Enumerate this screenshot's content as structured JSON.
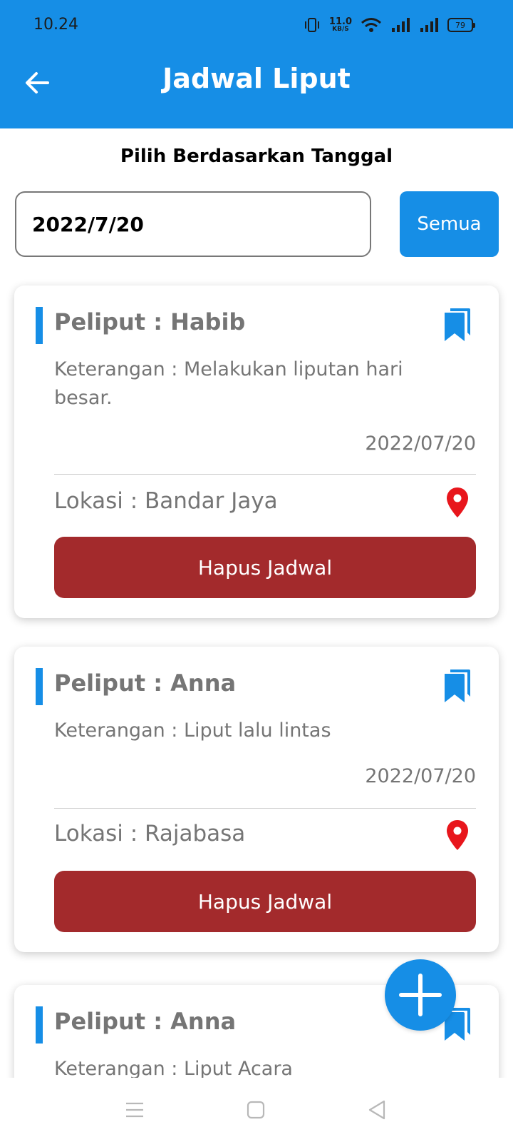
{
  "status_bar": {
    "time": "10.24",
    "net_speed_value": "11.0",
    "net_speed_unit": "KB/S",
    "battery": "79"
  },
  "appbar": {
    "title": "Jadwal Liput",
    "back_icon": "arrow-left-icon"
  },
  "filter": {
    "label": "Pilih Berdasarkan Tanggal",
    "date_value": "2022/7/20",
    "all_button": "Semua"
  },
  "schedules": [
    {
      "title": "Peliput : Habib",
      "description": "Keterangan : Melakukan liputan hari besar.",
      "date": "2022/07/20",
      "location": "Lokasi : Bandar Jaya",
      "delete_label": "Hapus Jadwal"
    },
    {
      "title": "Peliput : Anna",
      "description": "Keterangan : Liput lalu lintas",
      "date": "2022/07/20",
      "location": "Lokasi : Rajabasa",
      "delete_label": "Hapus Jadwal"
    },
    {
      "title": "Peliput : Anna",
      "description": "Keterangan : Liput Acara"
    }
  ],
  "colors": {
    "primary": "#168ee6",
    "delete": "#a32a2c",
    "pin": "#e8161c",
    "muted_text": "#757575"
  },
  "icons": {
    "bookmark": "bookmark-icon",
    "location": "location-pin-icon",
    "add": "plus-icon",
    "nav": [
      "menu-icon",
      "home-square-icon",
      "back-triangle-icon"
    ]
  }
}
